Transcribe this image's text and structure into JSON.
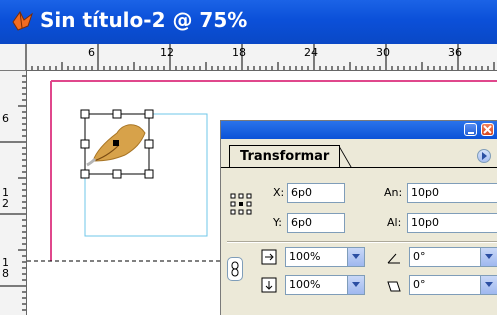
{
  "window": {
    "title": "Sin título-2 @ 75%"
  },
  "ruler": {
    "top_labels": [
      "6",
      "12",
      "18",
      "24",
      "30",
      "36"
    ],
    "left_labels": [
      "6",
      "1\n2",
      "1\n8"
    ]
  },
  "panel": {
    "tab_label": "Transformar",
    "x_label": "X:",
    "x_value": "6p0",
    "y_label": "Y:",
    "y_value": "6p0",
    "width_label": "An:",
    "width_value": "10p0",
    "height_label": "Al:",
    "height_value": "10p0",
    "scale_x_value": "100%",
    "scale_y_value": "100%",
    "rotate_value": "0°",
    "shear_value": "0°"
  },
  "icons": {
    "app": "indesign-butterfly-icon",
    "minimize": "minimize-icon",
    "close": "close-icon",
    "panel_menu": "panel-menu-arrow-icon",
    "reference_point": "reference-point-grid-icon",
    "constrain": "chain-link-icon",
    "scale_x": "scale-x-icon",
    "scale_y": "scale-y-icon",
    "rotate": "rotate-angle-icon",
    "shear": "shear-icon"
  },
  "colors": {
    "titlebar": "#0b50d9",
    "margin_guide": "#e0478c",
    "frame_guide": "#6fc7e8",
    "leaf": "#d7a24a"
  }
}
